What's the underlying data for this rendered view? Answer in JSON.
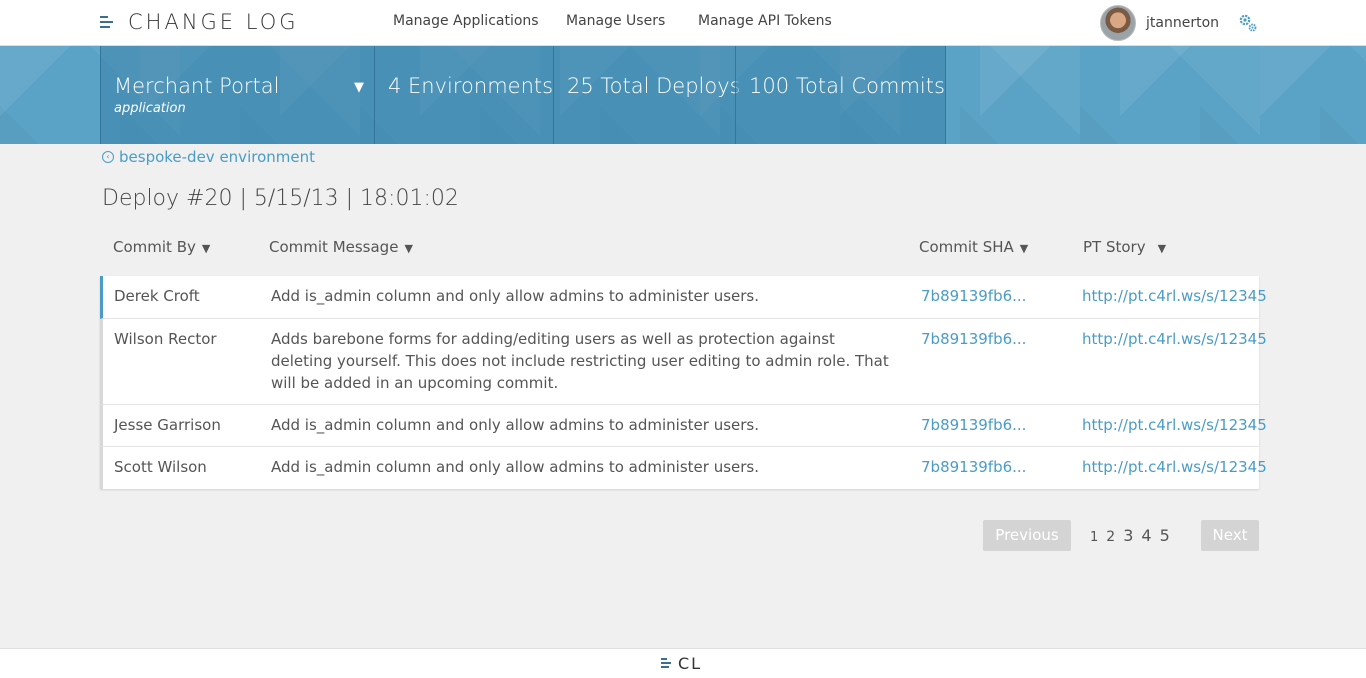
{
  "header": {
    "logo_text": "CHANGE LOG",
    "nav": [
      {
        "label": "Manage Applications"
      },
      {
        "label": "Manage Users"
      },
      {
        "label": "Manage API Tokens"
      }
    ],
    "username": "jtannerton",
    "icons": {
      "logo": "changelog-logo-icon",
      "settings": "gear-icon",
      "avatar": "user-avatar"
    }
  },
  "stats": {
    "application_name": "Merchant Portal",
    "application_sub": "application",
    "environments": "4 Environments",
    "deploys": "25 Total Deploys",
    "commits": "100 Total Commits"
  },
  "breadcrumb": {
    "label": "bespoke-dev environment"
  },
  "deploy": {
    "title": "Deploy #20  | 5/15/13 | 18:01:02"
  },
  "table": {
    "headers": {
      "commit_by": "Commit By",
      "commit_message": "Commit Message",
      "commit_sha": "Commit SHA",
      "pt_story": "PT Story"
    },
    "rows": [
      {
        "by": "Derek Croft",
        "message": "Add is_admin column and only allow admins to administer users.",
        "sha": "7b89139fb6...",
        "story": "http://pt.c4rl.ws/s/12345"
      },
      {
        "by": "Wilson Rector",
        "message": "Adds barebone forms for adding/editing users as well as protection against deleting yourself. This does not include restricting user editing to admin role. That will be added in an upcoming commit.",
        "sha": "7b89139fb6...",
        "story": "http://pt.c4rl.ws/s/12345"
      },
      {
        "by": "Jesse Garrison",
        "message": "Add is_admin column and only allow admins to administer users.",
        "sha": "7b89139fb6...",
        "story": "http://pt.c4rl.ws/s/12345"
      },
      {
        "by": "Scott Wilson",
        "message": "Add is_admin column and only allow admins to administer users.",
        "sha": "7b89139fb6...",
        "story": "http://pt.c4rl.ws/s/12345"
      }
    ]
  },
  "pagination": {
    "previous": "Previous",
    "next": "Next",
    "pages": [
      "1",
      "2",
      "3",
      "4",
      "5"
    ]
  },
  "footer": {
    "logo_text": "CL"
  },
  "colors": {
    "accent": "#4a9cc6",
    "band": "#5aa3c6"
  }
}
